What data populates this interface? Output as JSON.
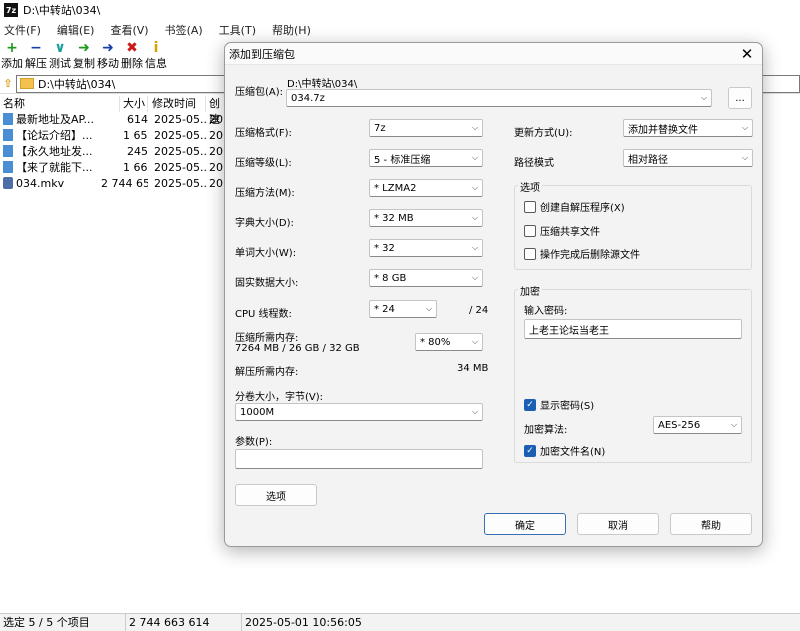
{
  "window": {
    "title": "D:\\中转站\\034\\",
    "app_icon": "7z"
  },
  "menu": [
    "文件(F)",
    "编辑(E)",
    "查看(V)",
    "书签(A)",
    "工具(T)",
    "帮助(H)"
  ],
  "toolbar": [
    {
      "label": "添加",
      "icon": "+",
      "color": "#1a9a1a"
    },
    {
      "label": "解压",
      "icon": "−",
      "color": "#1a3fa8"
    },
    {
      "label": "测试",
      "icon": "∨",
      "color": "#1aa0a0"
    },
    {
      "label": "复制",
      "icon": "➜",
      "color": "#1a9a1a"
    },
    {
      "label": "移动",
      "icon": "➜",
      "color": "#1a3fa8"
    },
    {
      "label": "删除",
      "icon": "✖",
      "color": "#cc1a1a"
    },
    {
      "label": "信息",
      "icon": "i",
      "color": "#d4a000"
    }
  ],
  "address": {
    "path": "D:\\中转站\\034\\"
  },
  "columns": [
    "名称",
    "大小",
    "修改时间",
    "创建"
  ],
  "files": [
    {
      "name": "最新地址及AP...",
      "size": "614",
      "modified": "2025-05...",
      "created": "20",
      "type": "doc"
    },
    {
      "name": "【论坛介绍】...",
      "size": "1 653",
      "modified": "2025-05...",
      "created": "20",
      "type": "doc"
    },
    {
      "name": "【永久地址发...",
      "size": "245",
      "modified": "2025-05...",
      "created": "20",
      "type": "doc"
    },
    {
      "name": "【来了就能下...",
      "size": "1 664",
      "modified": "2025-05...",
      "created": "20",
      "type": "doc"
    },
    {
      "name": "034.mkv",
      "size": "2 744 65...",
      "modified": "2025-05...",
      "created": "20",
      "type": "video"
    }
  ],
  "status": {
    "selected": "选定 5 / 5 个项目",
    "total_size": "2 744 663 614",
    "datetime": "2025-05-01 10:56:05"
  },
  "dialog": {
    "title": "添加到压缩包",
    "archive_label": "压缩包(A):",
    "archive_dir": "D:\\中转站\\034\\",
    "archive_name": "034.7z",
    "browse_label": "...",
    "format_label": "压缩格式(F):",
    "format_value": "7z",
    "level_label": "压缩等级(L):",
    "level_value": "5 - 标准压缩",
    "method_label": "压缩方法(M):",
    "method_value": "* LZMA2",
    "dict_label": "字典大小(D):",
    "dict_value": "* 32 MB",
    "word_label": "单词大小(W):",
    "word_value": "* 32",
    "solid_label": "固实数据大小:",
    "solid_value": "* 8 GB",
    "cpu_label": "CPU 线程数:",
    "cpu_value": "* 24",
    "cpu_total": "/ 24",
    "mem_label": "压缩所需内存:",
    "mem_detail": "7264 MB / 26 GB / 32 GB",
    "mem_value": "* 80%",
    "unmem_label": "解压所需内存:",
    "unmem_value": "34 MB",
    "split_label": "分卷大小，字节(V):",
    "split_value": "1000M",
    "params_label": "参数(P):",
    "params_value": "",
    "options_button": "选项",
    "update_label": "更新方式(U):",
    "update_value": "添加并替换文件",
    "path_label": "路径模式",
    "path_value": "相对路径",
    "options_group": "选项",
    "opt_sfx": "创建自解压程序(X)",
    "opt_shared": "压缩共享文件",
    "opt_delete": "操作完成后删除源文件",
    "enc_group": "加密",
    "password_label": "输入密码:",
    "password_value": "上老王论坛当老王",
    "show_password": "显示密码(S)",
    "enc_method_label": "加密算法:",
    "enc_method_value": "AES-256",
    "enc_names": "加密文件名(N)",
    "ok": "确定",
    "cancel": "取消",
    "help": "帮助"
  }
}
